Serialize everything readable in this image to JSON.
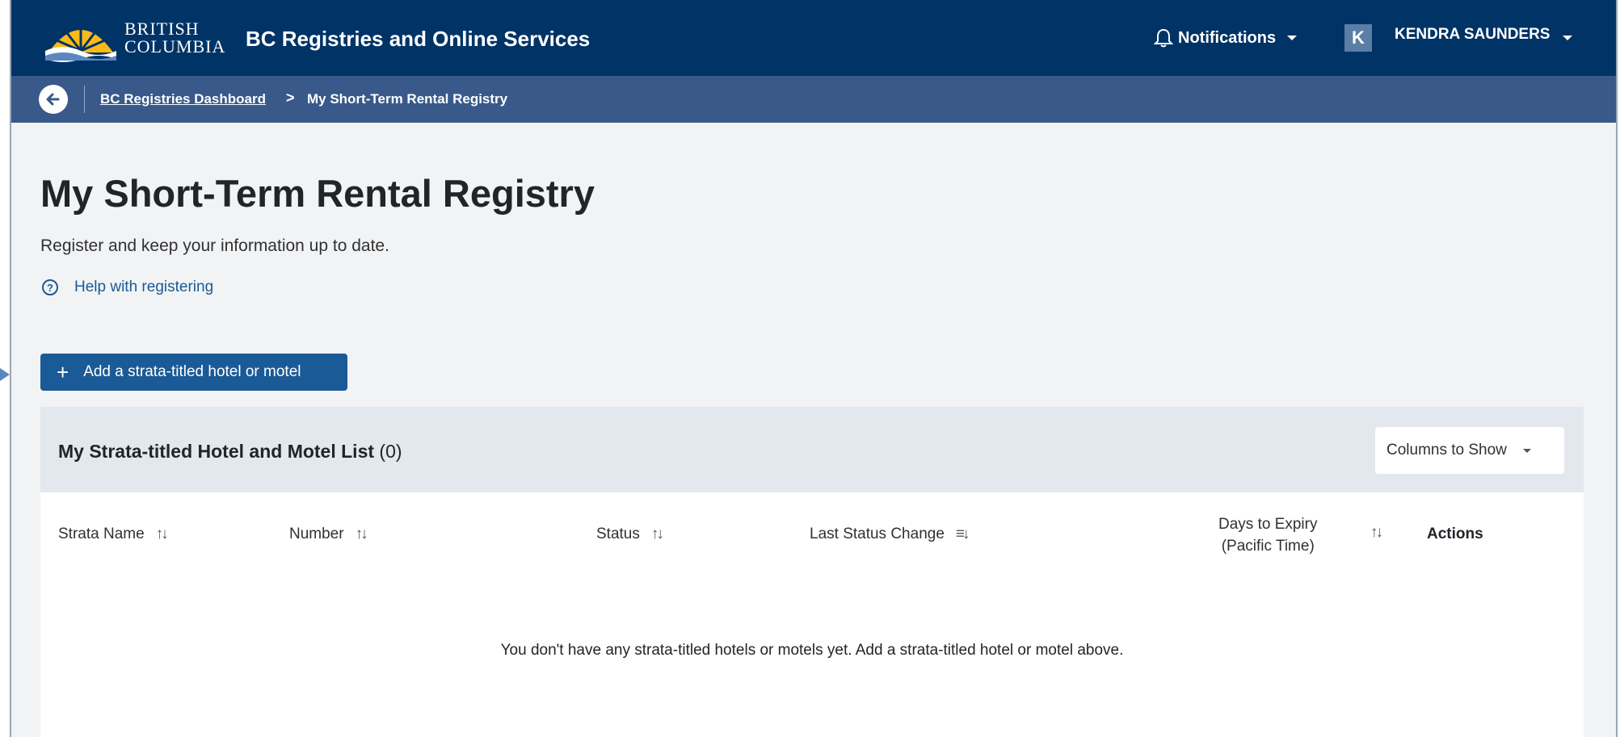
{
  "header": {
    "logo_line1": "BRITISH",
    "logo_line2": "COLUMBIA",
    "app_title": "BC Registries and Online Services",
    "notifications_label": "Notifications",
    "user_initial": "K",
    "user_name": "KENDRA SAUNDERS"
  },
  "breadcrumb": {
    "items": [
      "BC Registries Dashboard",
      "My Short-Term Rental Registry"
    ],
    "separator": ">"
  },
  "page": {
    "title": "My Short-Term Rental Registry",
    "subtitle": "Register and keep your information up to date.",
    "help_link": "Help with registering",
    "add_button": "Add a strata-titled hotel or motel"
  },
  "list": {
    "title": "My Strata-titled Hotel and Motel List",
    "count": "(0)",
    "columns_button": "Columns to Show",
    "columns": [
      {
        "label": "Strata Name",
        "sort_icon": "↑↓"
      },
      {
        "label": "Number",
        "sort_icon": "↑↓"
      },
      {
        "label": "Status",
        "sort_icon": "↑↓"
      },
      {
        "label": "Last Status Change",
        "sort_icon": "≡↓"
      },
      {
        "label": "Days to Expiry (Pacific Time)",
        "sort_icon": "↑↓"
      },
      {
        "label": "Actions"
      }
    ],
    "expiry_line1": "Days to Expiry",
    "expiry_line2": "(Pacific Time)",
    "empty_message": "You don't have any strata-titled hotels or motels yet. Add a strata-titled hotel or motel above."
  },
  "colors": {
    "header_bg": "#003366",
    "breadcrumb_bg": "#38598a",
    "primary_button": "#1a5a96",
    "page_bg": "#f1f3f5",
    "card_header_bg": "#e3e8ee"
  }
}
